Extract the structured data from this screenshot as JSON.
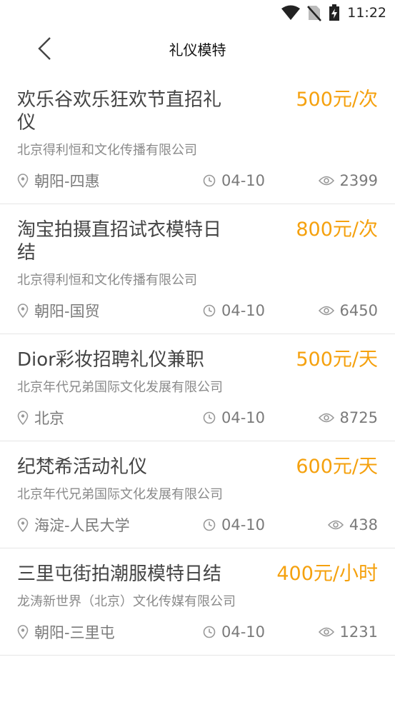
{
  "status_bar": {
    "time": "11:22"
  },
  "header": {
    "title": "礼仪模特"
  },
  "jobs": [
    {
      "title": "欢乐谷欢乐狂欢节直招礼仪",
      "price": "500元/次",
      "company": "北京得利恒和文化传播有限公司",
      "location": "朝阳-四惠",
      "date": "04-10",
      "views": "2399"
    },
    {
      "title": "淘宝拍摄直招试衣模特日结",
      "price": "800元/次",
      "company": "北京得利恒和文化传播有限公司",
      "location": "朝阳-国贸",
      "date": "04-10",
      "views": "6450"
    },
    {
      "title": "Dior彩妆招聘礼仪兼职",
      "price": "500元/天",
      "company": "北京年代兄弟国际文化发展有限公司",
      "location": "北京",
      "date": "04-10",
      "views": "8725"
    },
    {
      "title": "纪梵希活动礼仪",
      "price": "600元/天",
      "company": "北京年代兄弟国际文化发展有限公司",
      "location": "海淀-人民大学",
      "date": "04-10",
      "views": "438"
    },
    {
      "title": "三里屯街拍潮服模特日结",
      "price": "400元/小时",
      "company": "龙涛新世界（北京）文化传媒有限公司",
      "location": "朝阳-三里屯",
      "date": "04-10",
      "views": "1231"
    }
  ]
}
